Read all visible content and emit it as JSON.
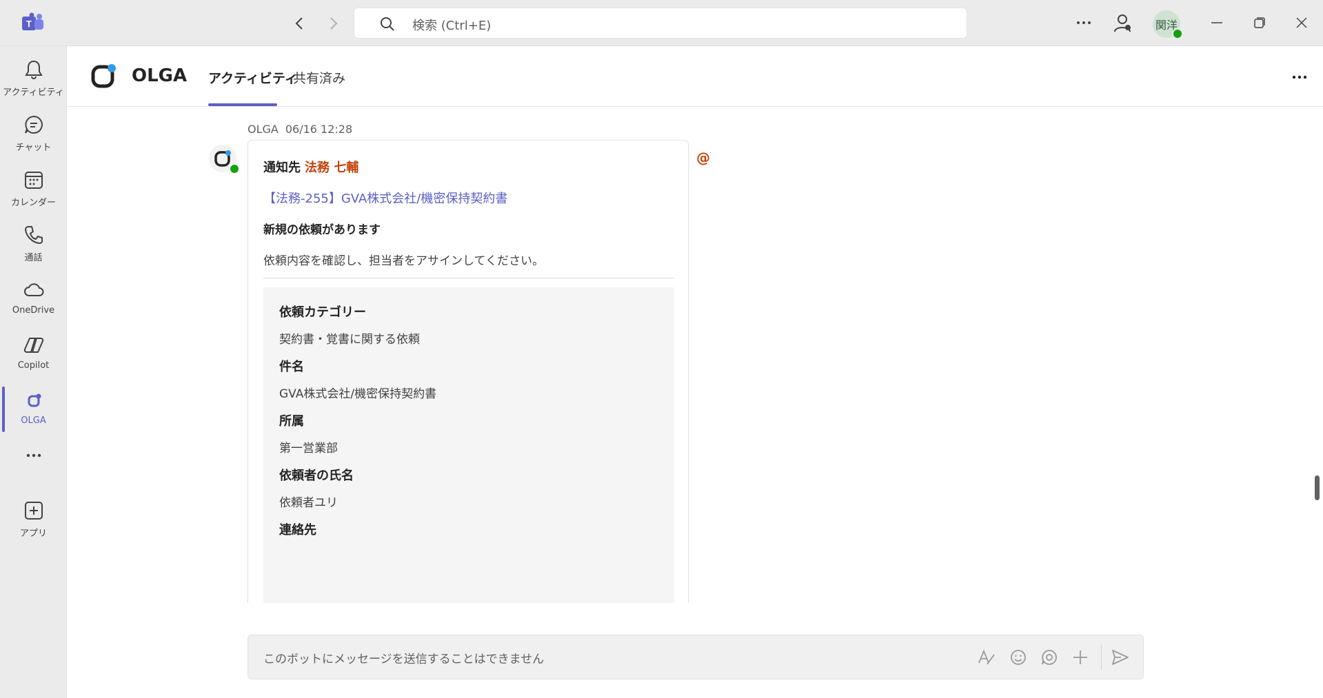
{
  "titlebar": {
    "search_placeholder": "検索 (Ctrl+E)",
    "user_initials": "関洋"
  },
  "rail": {
    "items": [
      {
        "label": "アクティビティ",
        "icon": "bell-icon"
      },
      {
        "label": "チャット",
        "icon": "chat-icon"
      },
      {
        "label": "カレンダー",
        "icon": "calendar-icon"
      },
      {
        "label": "通話",
        "icon": "phone-icon"
      },
      {
        "label": "OneDrive",
        "icon": "cloud-icon"
      },
      {
        "label": "Copilot",
        "icon": "copilot-icon"
      },
      {
        "label": "OLGA",
        "icon": "olga-icon"
      },
      {
        "label": "アプリ",
        "icon": "add-app-icon"
      }
    ],
    "active": "OLGA"
  },
  "app": {
    "name": "OLGA",
    "tabs": [
      {
        "label": "アクティビティ",
        "active": true
      },
      {
        "label": "共有済み",
        "active": false
      }
    ]
  },
  "message": {
    "sender": "OLGA",
    "time": "06/16 12:28",
    "notify_prefix": "通知先",
    "mention": "法務 七輔",
    "link": "【法務-255】GVA株式会社/機密保持契約書",
    "heading": "新規の依頼があります",
    "body": "依頼内容を確認し、担当者をアサインしてください。",
    "facts": [
      {
        "title": "依頼カテゴリー",
        "value": "契約書・覚書に関する依頼"
      },
      {
        "title": "件名",
        "value": "GVA株式会社/機密保持契約書"
      },
      {
        "title": "所属",
        "value": "第一営業部"
      },
      {
        "title": "依頼者の氏名",
        "value": "依頼者ユリ"
      },
      {
        "title": "連絡先",
        "value": ""
      }
    ],
    "at_symbol": "@"
  },
  "compose": {
    "placeholder": "このボットにメッセージを送信することはできません"
  },
  "colors": {
    "accent": "#5b5fc7",
    "mention": "#c4410c",
    "presence": "#13a10e"
  }
}
